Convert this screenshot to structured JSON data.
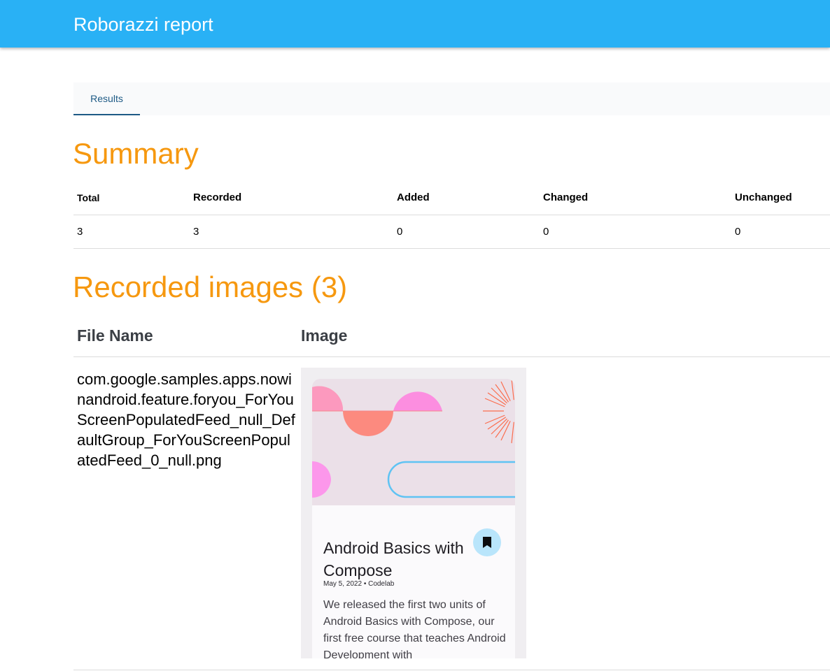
{
  "app_bar": {
    "title": "Roborazzi report"
  },
  "tabs": [
    {
      "label": "Results"
    }
  ],
  "summary": {
    "heading": "Summary",
    "columns": [
      "Total",
      "Recorded",
      "Added",
      "Changed",
      "Unchanged"
    ],
    "values": [
      "3",
      "3",
      "0",
      "0",
      "0"
    ]
  },
  "recorded": {
    "heading": "Recorded images (3)",
    "columns": [
      "File Name",
      "Image"
    ],
    "rows": [
      {
        "file_name": "com.google.samples.apps.nowinandroid.feature.foryou_ForYouScreenPopulatedFeed_null_DefaultGroup_ForYouScreenPopulatedFeed_0_null.png",
        "preview": {
          "title": "Android Basics with Compose",
          "meta": "May 5, 2022 • Codelab",
          "description": "We released the first two units of Android Basics with Compose, our first free course that teaches Android Development with",
          "bookmark_icon": "bookmark-icon"
        }
      }
    ]
  },
  "colors": {
    "app_bar": "#29b1f5",
    "heading": "#f6980f",
    "tab_active": "#1d5a85"
  }
}
